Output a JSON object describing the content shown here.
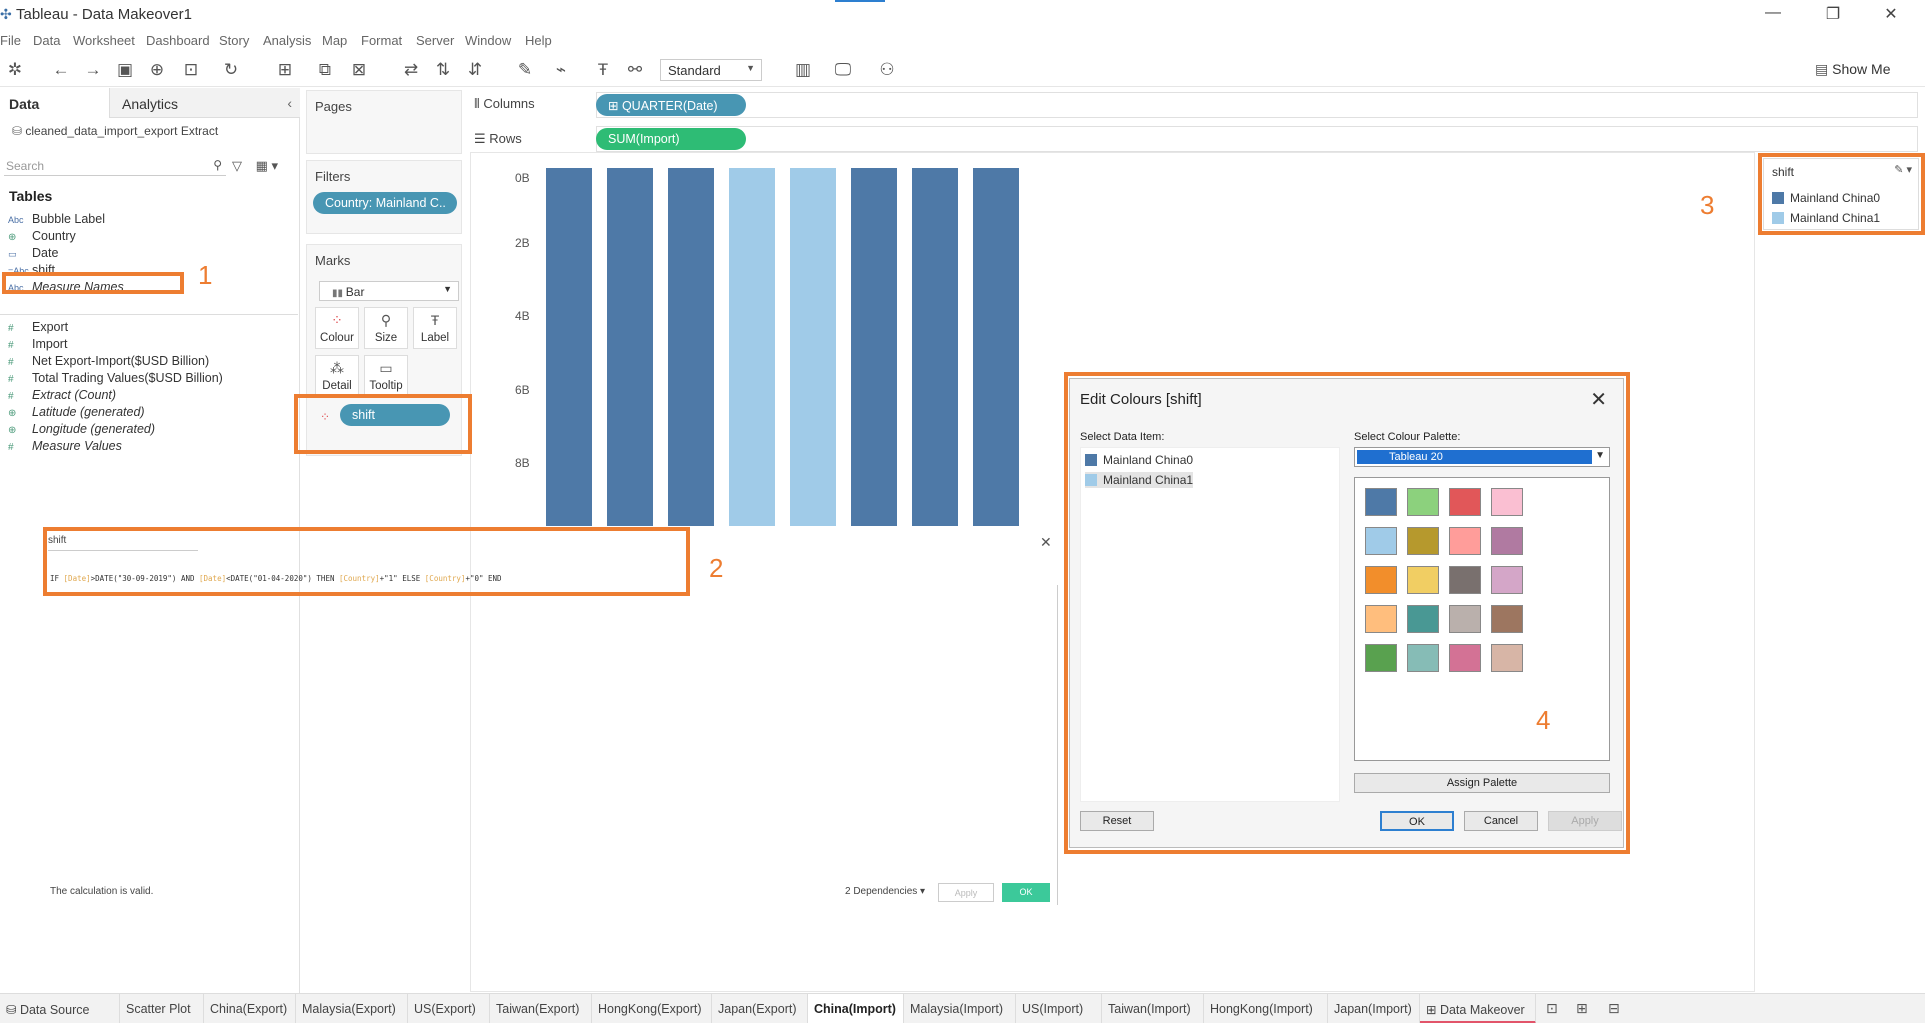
{
  "window": {
    "title": "Tableau - Data Makeover1"
  },
  "menu": [
    "File",
    "Data",
    "Worksheet",
    "Dashboard",
    "Story",
    "Analysis",
    "Map",
    "Format",
    "Server",
    "Window",
    "Help"
  ],
  "toolbar": {
    "fit_select": "Standard",
    "show_me": "Show Me"
  },
  "data_pane": {
    "tab_data": "Data",
    "tab_analytics": "Analytics",
    "datasource": "cleaned_data_import_export Extract",
    "search_placeholder": "Search",
    "tables_heading": "Tables",
    "dimensions": [
      {
        "label": "Bubble Label",
        "type": "abc"
      },
      {
        "label": "Country",
        "type": "globe"
      },
      {
        "label": "Date",
        "type": "date"
      },
      {
        "label": "shift",
        "type": "calc-abc"
      },
      {
        "label": "Measure Names",
        "type": "abc",
        "italic": true
      }
    ],
    "measures": [
      {
        "label": "Export",
        "italic": false
      },
      {
        "label": "Import",
        "italic": false
      },
      {
        "label": "Net Export-Import($USD Billion)",
        "italic": false
      },
      {
        "label": "Total Trading Values($USD Billion)",
        "italic": false
      },
      {
        "label": "Extract (Count)",
        "italic": true
      },
      {
        "label": "Latitude (generated)",
        "italic": true
      },
      {
        "label": "Longitude (generated)",
        "italic": true
      },
      {
        "label": "Measure Values",
        "italic": true
      }
    ]
  },
  "cards": {
    "pages": "Pages",
    "filters": "Filters",
    "filter_pill": "Country: Mainland C..",
    "marks": "Marks",
    "mark_type": "Bar",
    "mark_buttons": [
      "Colour",
      "Size",
      "Label",
      "Detail",
      "Tooltip"
    ],
    "colour_pill": "shift"
  },
  "shelves": {
    "columns_label": "Columns",
    "columns_pill": "QUARTER(Date)",
    "rows_label": "Rows",
    "rows_pill": "SUM(Import)"
  },
  "chart_data": {
    "type": "bar",
    "y_ticks": [
      "0B",
      "2B",
      "4B",
      "6B",
      "8B"
    ],
    "series": [
      {
        "name": "Mainland China0",
        "color": "#4e79a7"
      },
      {
        "name": "Mainland China1",
        "color": "#a0cbe8"
      }
    ],
    "bars": [
      {
        "series": 0
      },
      {
        "series": 0
      },
      {
        "series": 0
      },
      {
        "series": 1
      },
      {
        "series": 1
      },
      {
        "series": 0
      },
      {
        "series": 0
      },
      {
        "series": 0
      }
    ]
  },
  "legend": {
    "title": "shift",
    "items": [
      "Mainland China0",
      "Mainland China1"
    ]
  },
  "calc_editor": {
    "name": "shift",
    "formula_prefix": "IF ",
    "formula_date1": "[Date]",
    "formula_mid1": ">DATE(\"30-09-2019\") AND ",
    "formula_date2": "[Date]",
    "formula_mid2": "<DATE(\"01-04-2020\") THEN ",
    "formula_country1": "[Country]",
    "formula_mid3": "+\"1\" ELSE ",
    "formula_country2": "[Country]",
    "formula_end": "+\"0\" END",
    "status": "The calculation is valid.",
    "dependencies": "2 Dependencies ▾",
    "apply": "Apply",
    "ok": "OK"
  },
  "dialog": {
    "title": "Edit Colours [shift]",
    "select_item_label": "Select Data Item:",
    "items": [
      {
        "label": "Mainland China0",
        "color": "#4e79a7"
      },
      {
        "label": "Mainland China1",
        "color": "#a0cbe8"
      }
    ],
    "palette_label": "Select Colour Palette:",
    "palette": "Tableau 20",
    "swatches": [
      "#4e79a7",
      "#8cd17d",
      "#e15759",
      "#fabfd2",
      "#a0cbe8",
      "#b6992d",
      "#ff9d9a",
      "#b07aa1",
      "#f28e2b",
      "#f1ce63",
      "#79706e",
      "#d4a6c8",
      "#ffbe7d",
      "#499894",
      "#bab0ac",
      "#9d7660",
      "#59a14f",
      "#86bcb6",
      "#d37295",
      "#d7b5a6"
    ],
    "assign": "Assign Palette",
    "reset": "Reset",
    "ok": "OK",
    "cancel": "Cancel",
    "apply": "Apply"
  },
  "callouts": [
    "1",
    "2",
    "3",
    "4"
  ],
  "sheets": [
    {
      "label": "Data Source"
    },
    {
      "label": "Scatter Plot"
    },
    {
      "label": "China(Export)"
    },
    {
      "label": "Malaysia(Export)"
    },
    {
      "label": "US(Export)"
    },
    {
      "label": "Taiwan(Export)"
    },
    {
      "label": "HongKong(Export)"
    },
    {
      "label": "Japan(Export)"
    },
    {
      "label": "China(Import)",
      "active": true
    },
    {
      "label": "Malaysia(Import)"
    },
    {
      "label": "US(Import)"
    },
    {
      "label": "Taiwan(Import)"
    },
    {
      "label": "HongKong(Import)"
    },
    {
      "label": "Japan(Import)"
    },
    {
      "label": "Data Makeover",
      "dashboard": true
    }
  ]
}
